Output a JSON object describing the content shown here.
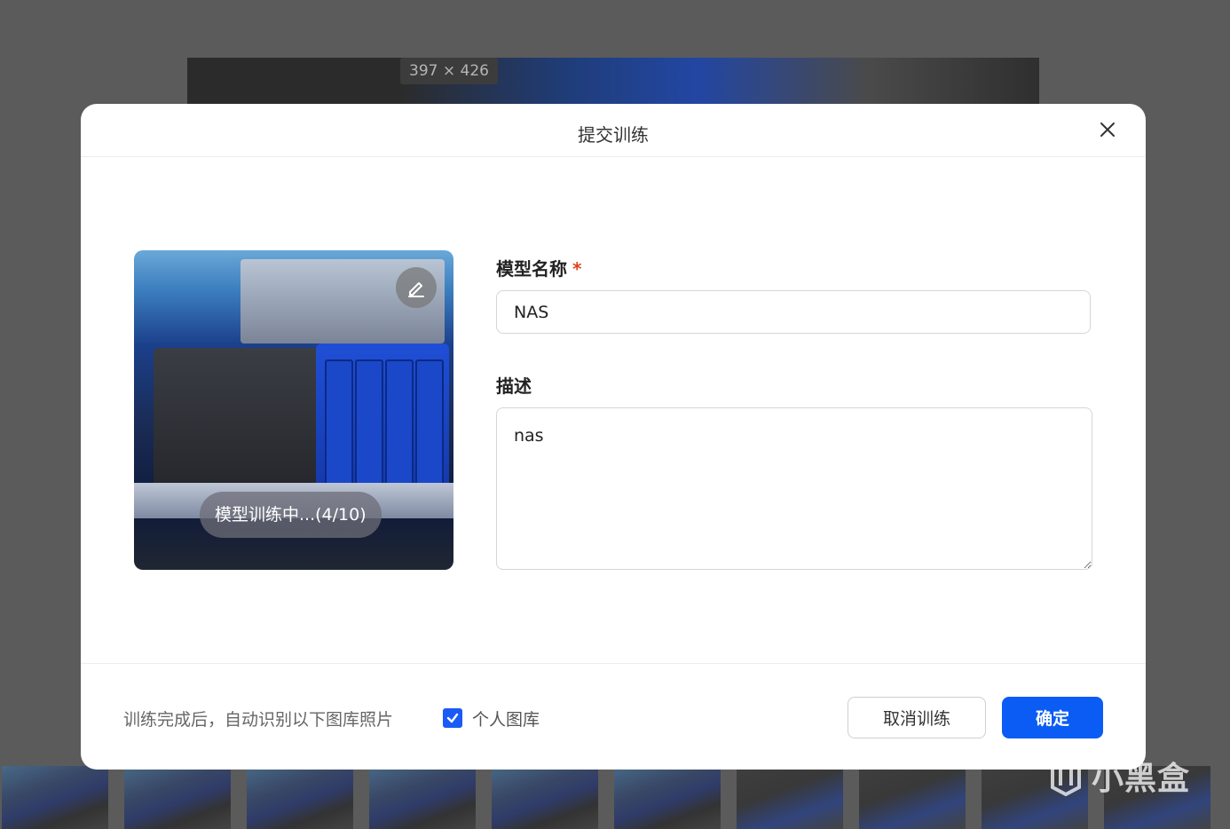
{
  "background": {
    "image_size_badge": "397 × 426",
    "watermark_text": "小黑盒"
  },
  "modal": {
    "title": "提交训练",
    "preview": {
      "training_status": "模型训练中...(4/10)"
    },
    "form": {
      "name_label": "模型名称",
      "required_mark": "*",
      "name_value": "NAS",
      "description_label": "描述",
      "description_value": "nas"
    },
    "footer": {
      "auto_recognize_text": "训练完成后，自动识别以下图库照片",
      "library_checkbox_label": "个人图库",
      "library_checked": true,
      "cancel_button": "取消训练",
      "confirm_button": "确定"
    }
  },
  "colors": {
    "primary": "#0a5cf5",
    "required": "#e0401f",
    "overlay": "#5b5b5b"
  },
  "icons": {
    "close": "close-icon",
    "edit": "pencil-icon",
    "check": "check-icon"
  }
}
